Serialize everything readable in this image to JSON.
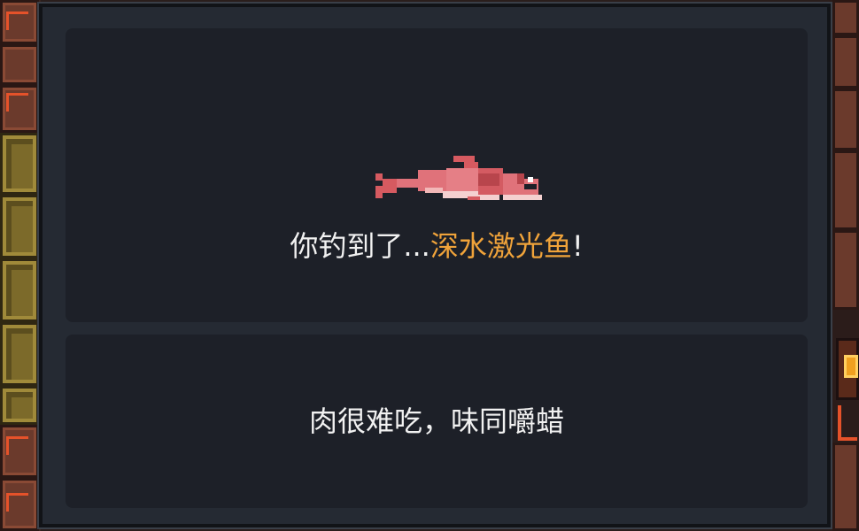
{
  "dialog": {
    "catch_prefix": "你钓到了...",
    "fish_name": "深水激光鱼",
    "catch_suffix": "!",
    "description": "肉很难吃，味同嚼蜡",
    "fish_icon": "pink-fish-sprite",
    "fish_name_color": "#f0a33a"
  },
  "background": {
    "left_wall_icon": "brick-wall",
    "right_wall_icon": "torch-lamp"
  }
}
